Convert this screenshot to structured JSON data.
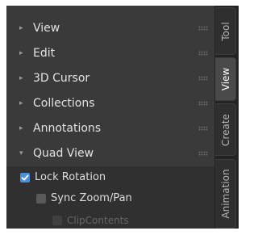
{
  "sections": [
    {
      "label": "View",
      "arrow": "▸"
    },
    {
      "label": "Edit",
      "arrow": "▸"
    },
    {
      "label": "3D Cursor",
      "arrow": "▸"
    },
    {
      "label": "Collections",
      "arrow": "▸"
    },
    {
      "label": "Annotations",
      "arrow": "▸"
    },
    {
      "label": "Quad View",
      "arrow": "▾"
    }
  ],
  "quad_view": {
    "lock_rotation": {
      "label": "Lock Rotation",
      "checked": true
    },
    "sync_zoom_pan": {
      "label": "Sync Zoom/Pan",
      "checked": false
    },
    "clip_contents": {
      "label": "ClipContents",
      "checked": false
    }
  },
  "tabs": [
    {
      "label": "Tool",
      "active": false
    },
    {
      "label": "View",
      "active": true
    },
    {
      "label": "Create",
      "active": false
    },
    {
      "label": "Animation",
      "active": false
    }
  ],
  "colors": {
    "panel_bg": "#3a3a3a",
    "content_bg": "#303030",
    "accent": "#4c8ed9",
    "text": "#e3e3e3"
  }
}
